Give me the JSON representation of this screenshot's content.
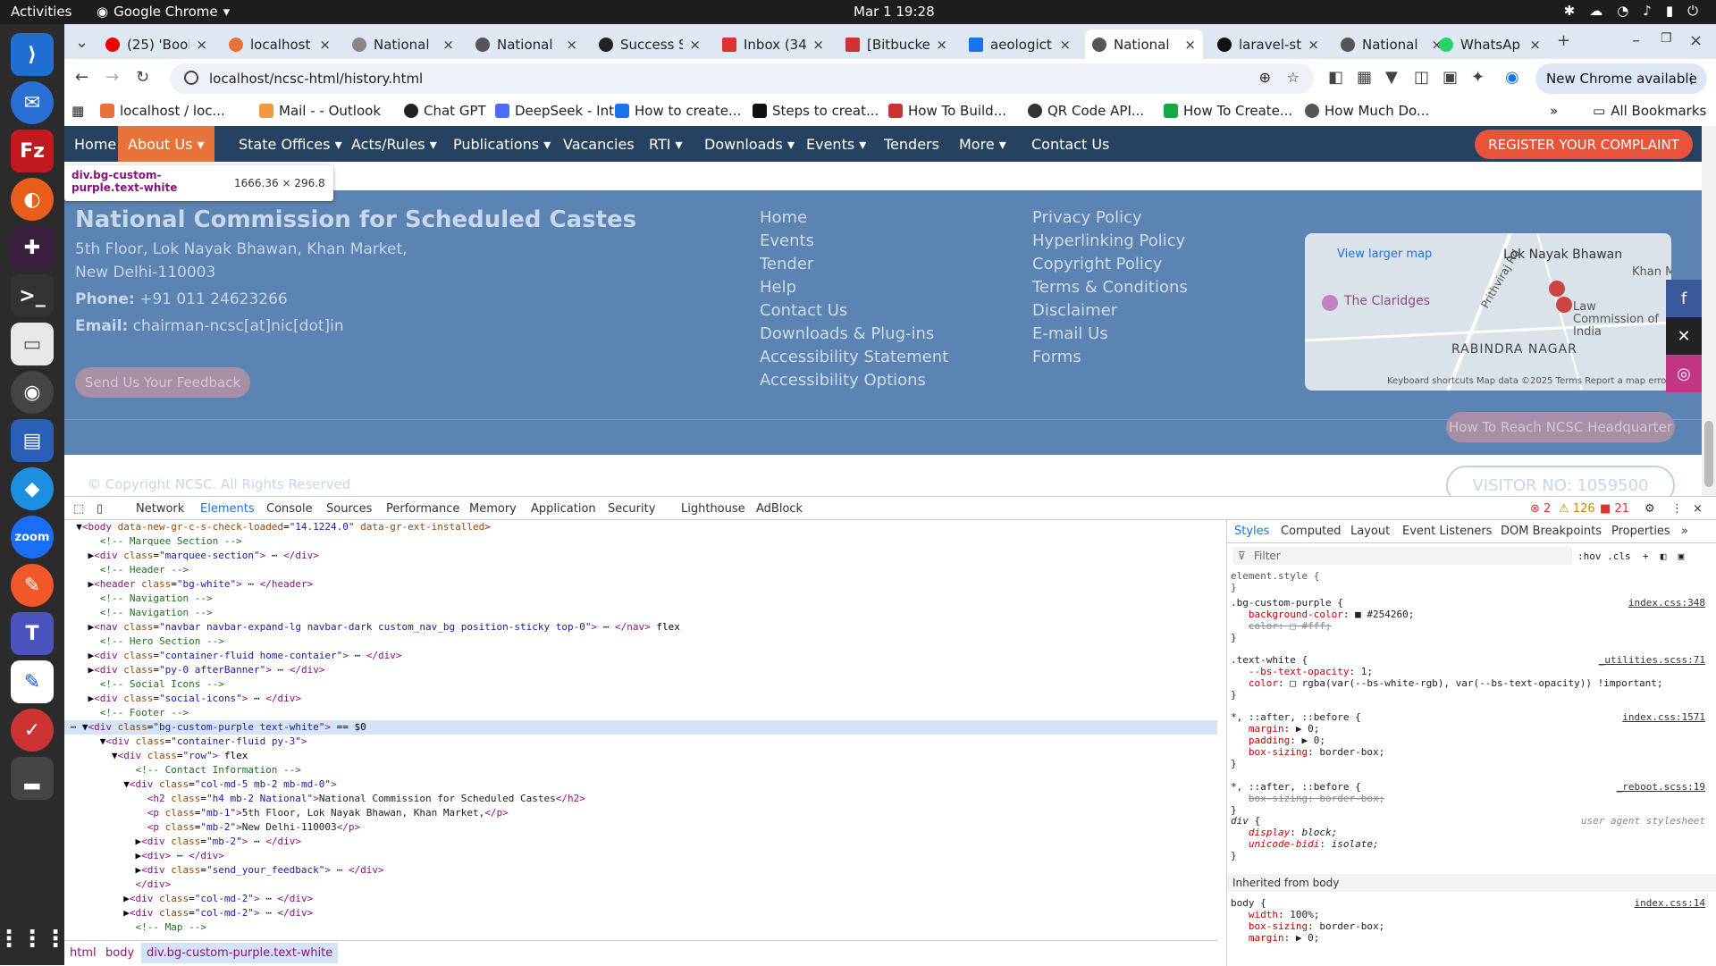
{
  "os": {
    "activities": "Activities",
    "app": "Google Chrome",
    "clock": "Mar 1  19:28"
  },
  "tabs": [
    {
      "label": "(25) 'Bool",
      "color": "#e00"
    },
    {
      "label": "localhost",
      "color": "#e8733a"
    },
    {
      "label": "National",
      "color": "#888"
    },
    {
      "label": "National",
      "color": "#555"
    },
    {
      "label": "Success S",
      "color": "#222"
    },
    {
      "label": "Inbox (34",
      "color": "#d33"
    },
    {
      "label": "[Bitbucke",
      "color": "#c33"
    },
    {
      "label": "aeologict",
      "color": "#1a73e8"
    },
    {
      "label": "National",
      "color": "#555"
    },
    {
      "label": "laravel-st",
      "color": "#111"
    },
    {
      "label": "National",
      "color": "#555"
    },
    {
      "label": "WhatsAp",
      "color": "#25d366"
    }
  ],
  "address": {
    "url": "localhost/ncsc-html/history.html",
    "update": "New Chrome available"
  },
  "bookmarks": [
    {
      "label": "localhost / loc...",
      "color": "#e8733a"
    },
    {
      "label": "Mail - - Outlook",
      "color": "#e94"
    },
    {
      "label": "Chat GPT",
      "color": "#222"
    },
    {
      "label": "DeepSeek - Int...",
      "color": "#4d6bfe"
    },
    {
      "label": "How to create...",
      "color": "#1a73e8"
    },
    {
      "label": "Steps to creat...",
      "color": "#111"
    },
    {
      "label": "How To Build...",
      "color": "#c33"
    },
    {
      "label": "QR Code API...",
      "color": "#333"
    },
    {
      "label": "How To Create...",
      "color": "#1a4"
    },
    {
      "label": "How Much Do...",
      "color": "#555"
    }
  ],
  "all_bookmarks": "All Bookmarks",
  "site_nav": {
    "items": [
      "Home",
      "About Us ▾",
      "State Offices ▾",
      "Acts/Rules ▾",
      "Publications ▾",
      "Vacancies",
      "RTI ▾",
      "Downloads ▾",
      "Events ▾",
      "Tenders",
      "More ▾",
      "Contact Us"
    ],
    "register": "REGISTER YOUR COMPLAINT"
  },
  "tooltip": {
    "selector": "div.bg-custom-purple.text-white",
    "size": "1666.36 × 296.8"
  },
  "footer": {
    "org": "National Commission for Scheduled Castes",
    "addr1": "5th Floor, Lok Nayak Bhawan, Khan Market,",
    "addr2": "New Delhi-110003",
    "phone_label": "Phone:",
    "phone": "+91 011 24623266",
    "email_label": "Email:",
    "email": "chairman-ncsc[at]nic[dot]in",
    "feedback": "Send Us Your Feedback",
    "links1": [
      "Home",
      "Events",
      "Tender",
      "Help",
      "Contact Us",
      "Downloads & Plug-ins",
      "Accessibility Statement",
      "Accessibility Options"
    ],
    "links2": [
      "Privacy Policy",
      "Hyperlinking Policy",
      "Copyright Policy",
      "Terms & Conditions",
      "Disclaimer",
      "E-mail Us",
      "Forms"
    ],
    "map": {
      "larger": "View larger map",
      "place1": "Lok Nayak Bhawan",
      "place2": "The Claridges",
      "place3": "Law Commission of India",
      "place4": "RABINDRA NAGAR",
      "place5": "Prithviraj Rd",
      "place6": "Khan M",
      "footer": "Keyboard shortcuts   Map data ©2025   Terms   Report a map error"
    },
    "hq": "How To Reach NCSC Headquarter",
    "copyright": "© Copyright NCSC. All Rights Reserved",
    "visitor": "VISITOR NO: 1059500"
  },
  "devtools": {
    "tabs": [
      "Network",
      "Elements",
      "Console",
      "Sources",
      "Performance",
      "Memory",
      "Application",
      "Security",
      "Lighthouse",
      "AdBlock"
    ],
    "counts": {
      "errors": "2",
      "warnings": "126",
      "issues": "21"
    },
    "crumbs": [
      "html",
      "body",
      "div.bg-custom-purple.text-white"
    ],
    "style_tabs": [
      "Styles",
      "Computed",
      "Layout",
      "Event Listeners",
      "DOM Breakpoints",
      "Properties"
    ],
    "filter": "Filter",
    "inherited": "Inherited from body"
  }
}
